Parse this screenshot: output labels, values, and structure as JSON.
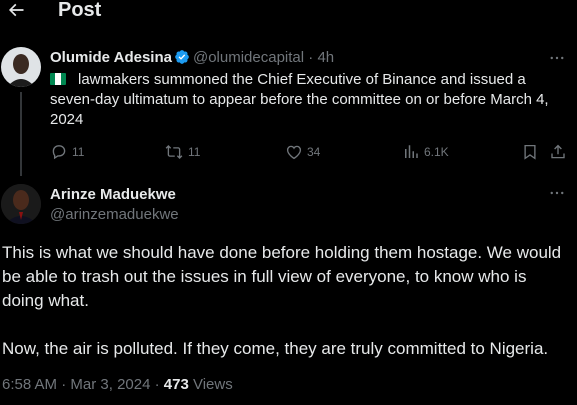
{
  "header": {
    "title": "Post"
  },
  "parent_tweet": {
    "name": "Olumide Adesina",
    "handle": "@olumidecapital",
    "separator": "·",
    "time": "4h",
    "text": "lawmakers summoned the Chief Executive of Binance and issued a seven-day ultimatum to appear before the committee on or before March 4, 2024",
    "flag_colors": [
      "#008751",
      "#ffffff",
      "#008751"
    ],
    "actions": {
      "replies": "11",
      "reposts": "11",
      "likes": "34",
      "views": "6.1K"
    }
  },
  "main_tweet": {
    "name": "Arinze Maduekwe",
    "handle": "@arinzemaduekwe",
    "paragraph_1": "This is what we should have done before holding them hostage. We would be able to trash out the issues in full view of everyone, to know who is doing what.",
    "paragraph_2": "Now, the air is polluted. If they come, they are truly committed to Nigeria.",
    "time": "6:58 AM",
    "separator_1": "·",
    "date": "Mar 3, 2024",
    "separator_2": "·",
    "views_count": "473",
    "views_label": "Views"
  },
  "icons": {
    "back": "arrow-left-icon",
    "verified": "verified-badge-icon",
    "more": "more-horizontal-icon",
    "reply": "reply-icon",
    "repost": "repost-icon",
    "like": "heart-icon",
    "views": "bar-chart-icon",
    "bookmark": "bookmark-icon",
    "share": "share-icon"
  },
  "colors": {
    "accent": "#1d9bf0",
    "muted": "#71767b",
    "text": "#e7e9ea",
    "background": "#000000"
  }
}
